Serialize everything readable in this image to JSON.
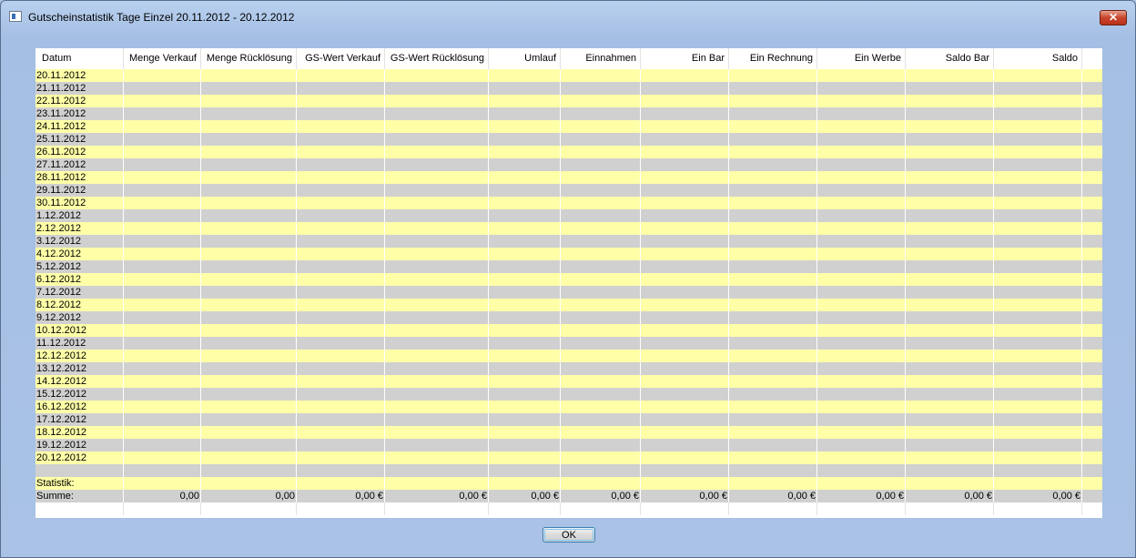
{
  "window": {
    "title": "Gutscheinstatistik Tage Einzel 20.11.2012 - 20.12.2012",
    "close_label": "✕"
  },
  "table": {
    "columns": [
      "Datum",
      "Menge Verkauf",
      "Menge Rücklösung",
      "GS-Wert Verkauf",
      "GS-Wert Rücklösung",
      "Umlauf",
      "Einnahmen",
      "Ein Bar",
      "Ein Rechnung",
      "Ein Werbe",
      "Saldo Bar",
      "Saldo"
    ],
    "dates": [
      "20.11.2012",
      "21.11.2012",
      "22.11.2012",
      "23.11.2012",
      "24.11.2012",
      "25.11.2012",
      "26.11.2012",
      "27.11.2012",
      "28.11.2012",
      "29.11.2012",
      "30.11.2012",
      " 1.12.2012",
      " 2.12.2012",
      " 3.12.2012",
      " 4.12.2012",
      " 5.12.2012",
      " 6.12.2012",
      " 7.12.2012",
      " 8.12.2012",
      " 9.12.2012",
      "10.12.2012",
      "11.12.2012",
      "12.12.2012",
      "13.12.2012",
      "14.12.2012",
      "15.12.2012",
      "16.12.2012",
      "17.12.2012",
      "18.12.2012",
      "19.12.2012",
      "20.12.2012"
    ],
    "statistik_label": "Statistik:",
    "summe_label": "Summe:",
    "summe_values": [
      "0,00",
      "0,00",
      "0,00 €",
      "0,00 €",
      "0,00 €",
      "0,00 €",
      "0,00 €",
      "0,00 €",
      "0,00 €",
      "0,00 €",
      "0,00 €"
    ]
  },
  "buttons": {
    "ok": "OK"
  },
  "colors": {
    "row_yellow": "#ffffa8",
    "row_gray": "#d0d0d0",
    "window_bg": "#aec6e6"
  }
}
